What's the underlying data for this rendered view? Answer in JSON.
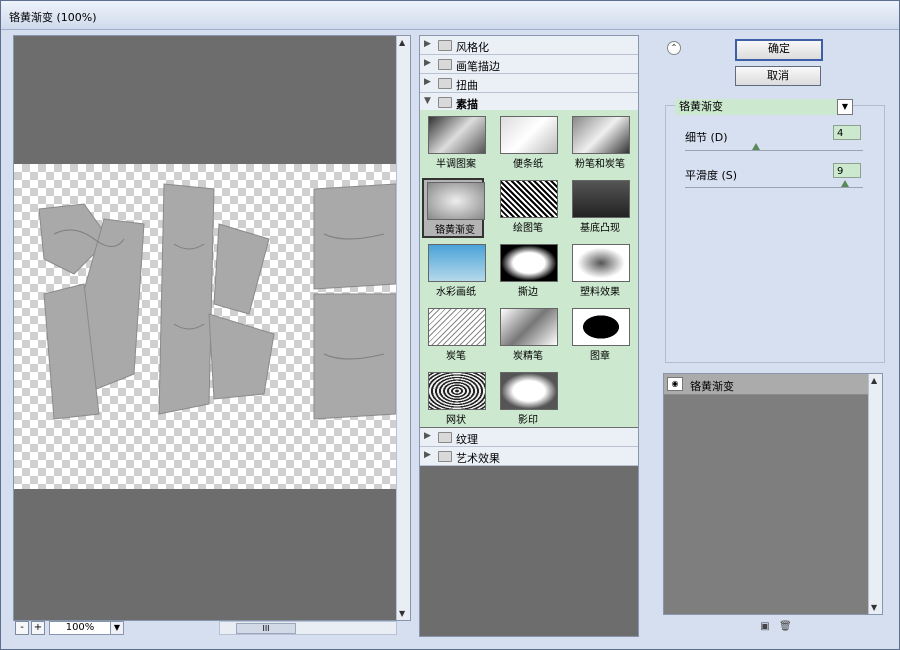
{
  "window": {
    "title": "铬黄渐变 (100%)"
  },
  "preview": {
    "zoom": "100%",
    "minus_label": "-",
    "plus_label": "+",
    "thumb_label": "III"
  },
  "gallery": {
    "categories": [
      {
        "label": "风格化",
        "open": false
      },
      {
        "label": "画笔描边",
        "open": false
      },
      {
        "label": "扭曲",
        "open": false
      },
      {
        "label": "素描",
        "open": true
      },
      {
        "label": "纹理",
        "open": false
      },
      {
        "label": "艺术效果",
        "open": false
      }
    ],
    "sketch_filters": [
      "半调图案",
      "便条纸",
      "粉笔和炭笔",
      "铬黄渐变",
      "绘图笔",
      "基底凸现",
      "水彩画纸",
      "撕边",
      "塑料效果",
      "炭笔",
      "炭精笔",
      "图章",
      "网状",
      "影印"
    ],
    "selected_filter": "铬黄渐变"
  },
  "buttons": {
    "ok": "确定",
    "cancel": "取消"
  },
  "settings": {
    "filter_name": "铬黄渐变",
    "detail": {
      "label": "细节 (D)",
      "value": "4",
      "level_fraction": 0.4
    },
    "smoothness": {
      "label": "平滑度 (S)",
      "value": "9",
      "level_fraction": 0.9
    }
  },
  "layers": {
    "items": [
      {
        "label": "铬黄渐变"
      }
    ]
  },
  "colors": {
    "thumb_area": "#cce8cf",
    "window_bg": "#d6dff0",
    "preview_bg": "#6d6d6d"
  }
}
